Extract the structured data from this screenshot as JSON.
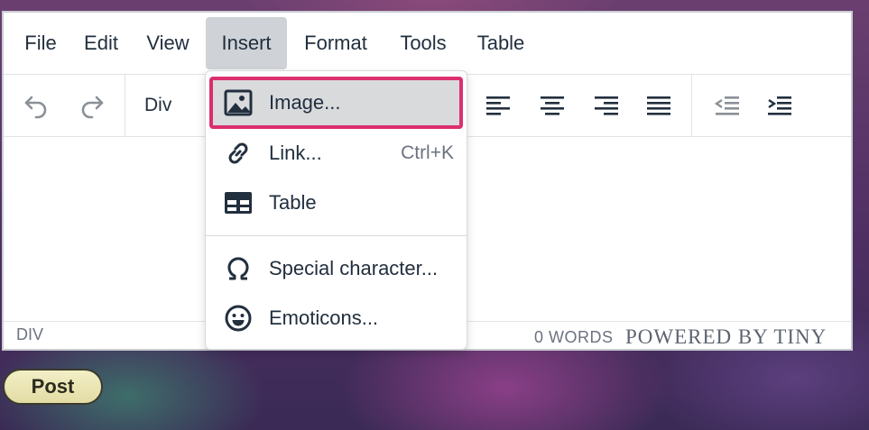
{
  "menubar": {
    "items": [
      {
        "label": "File"
      },
      {
        "label": "Edit"
      },
      {
        "label": "View"
      },
      {
        "label": "Insert",
        "active": true
      },
      {
        "label": "Format"
      },
      {
        "label": "Tools"
      },
      {
        "label": "Table"
      }
    ]
  },
  "toolbar": {
    "block_format": "Div",
    "icons": [
      "undo-icon",
      "redo-icon",
      "align-left-icon",
      "align-center-icon",
      "align-right-icon",
      "align-justify-icon",
      "outdent-icon",
      "indent-icon"
    ]
  },
  "insert_menu": {
    "items": [
      {
        "label": "Image...",
        "icon": "image-icon",
        "shortcut": "",
        "highlighted": true
      },
      {
        "label": "Link...",
        "icon": "link-icon",
        "shortcut": "Ctrl+K"
      },
      {
        "label": "Table",
        "icon": "table-icon",
        "shortcut": ""
      },
      {
        "label": "Special character...",
        "icon": "omega-icon",
        "shortcut": ""
      },
      {
        "label": "Emoticons...",
        "icon": "emoticon-icon",
        "shortcut": ""
      }
    ]
  },
  "statusbar": {
    "path": "DIV",
    "word_count": "0 WORDS",
    "branding": "POWERED BY TINY"
  },
  "post_button": {
    "label": "Post"
  },
  "colors": {
    "highlight_outline": "#db2f6f",
    "text": "#222f3e",
    "menu_active_bg": "#cfd2d6"
  }
}
